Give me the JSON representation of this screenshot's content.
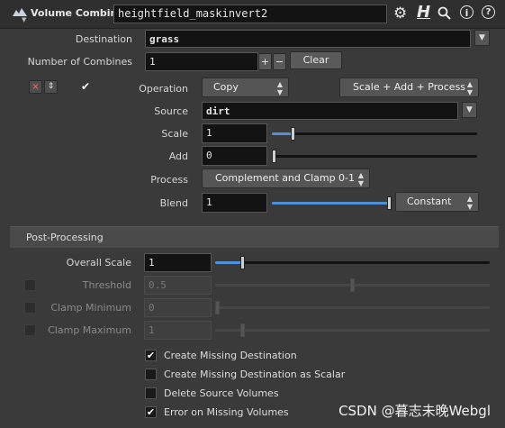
{
  "header": {
    "node_type": "Volume Combine",
    "node_name": "heightfield_maskinvert2",
    "icons": [
      "gear-icon",
      "houdini-help-icon",
      "search-icon",
      "info-icon",
      "help-icon"
    ],
    "icon_glyphs": {
      "gear": "⚙",
      "h": "H",
      "search": "⚲",
      "info": "ⓘ",
      "help": "?"
    }
  },
  "params": {
    "destination": {
      "label": "Destination",
      "value": "grass"
    },
    "num_combines": {
      "label": "Number of Combines",
      "value": "1",
      "plus": "+",
      "minus": "−",
      "clear": "Clear"
    },
    "small_buttons": {
      "remove": "×",
      "move": "⇕"
    },
    "operation": {
      "label": "Operation",
      "value": "Copy",
      "adjust": "Scale + Add + Process"
    },
    "source": {
      "label": "Source",
      "value": "dirt"
    },
    "scale": {
      "label": "Scale",
      "value": "1",
      "slider_fraction": 0.1
    },
    "add": {
      "label": "Add",
      "value": "0",
      "slider_fraction": 0.0
    },
    "process": {
      "label": "Process",
      "value": "Complement and Clamp 0-1"
    },
    "blend": {
      "label": "Blend",
      "value": "1",
      "slider_fraction": 1.0,
      "mode": "Constant"
    }
  },
  "post_processing": {
    "title": "Post-Processing",
    "overall_scale": {
      "label": "Overall Scale",
      "value": "1",
      "slider_fraction": 0.1
    },
    "threshold": {
      "label": "Threshold",
      "value": "0.5",
      "slider_fraction": 0.5
    },
    "clamp_min": {
      "label": "Clamp Minimum",
      "value": "0",
      "slider_fraction": 0.0
    },
    "clamp_max": {
      "label": "Clamp Maximum",
      "value": "1",
      "slider_fraction": 0.1
    }
  },
  "options": [
    {
      "label": "Create Missing Destination",
      "checked": true
    },
    {
      "label": "Create Missing Destination as Scalar",
      "checked": false
    },
    {
      "label": "Delete Source Volumes",
      "checked": false
    },
    {
      "label": "Error on Missing Volumes",
      "checked": true
    }
  ],
  "check_glyph": "✔",
  "watermark": "CSDN @暮志未晚Webgl",
  "colors": {
    "accent": "#4f8fd8",
    "background": "#3a3a3a",
    "field": "#131313"
  }
}
